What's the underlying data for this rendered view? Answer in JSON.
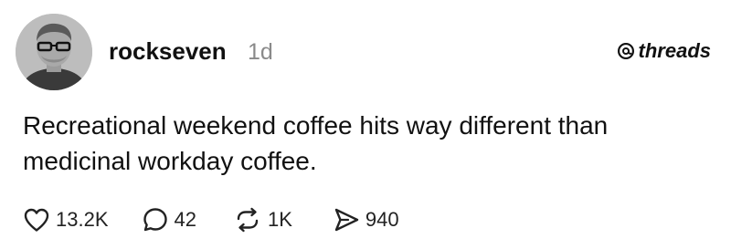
{
  "post": {
    "username": "rockseven",
    "timestamp": "1d",
    "brand": "threads",
    "text": "Recreational weekend coffee hits way different than\nmedicinal workday coffee.",
    "actions": {
      "likes": "13.2K",
      "replies": "42",
      "reposts": "1K",
      "shares": "940"
    }
  },
  "icons": {
    "avatar": "avatar-photo",
    "brand": "threads-logo-icon",
    "like": "heart-icon",
    "reply": "speech-bubble-icon",
    "repost": "repost-arrows-icon",
    "share": "send-paper-plane-icon"
  }
}
